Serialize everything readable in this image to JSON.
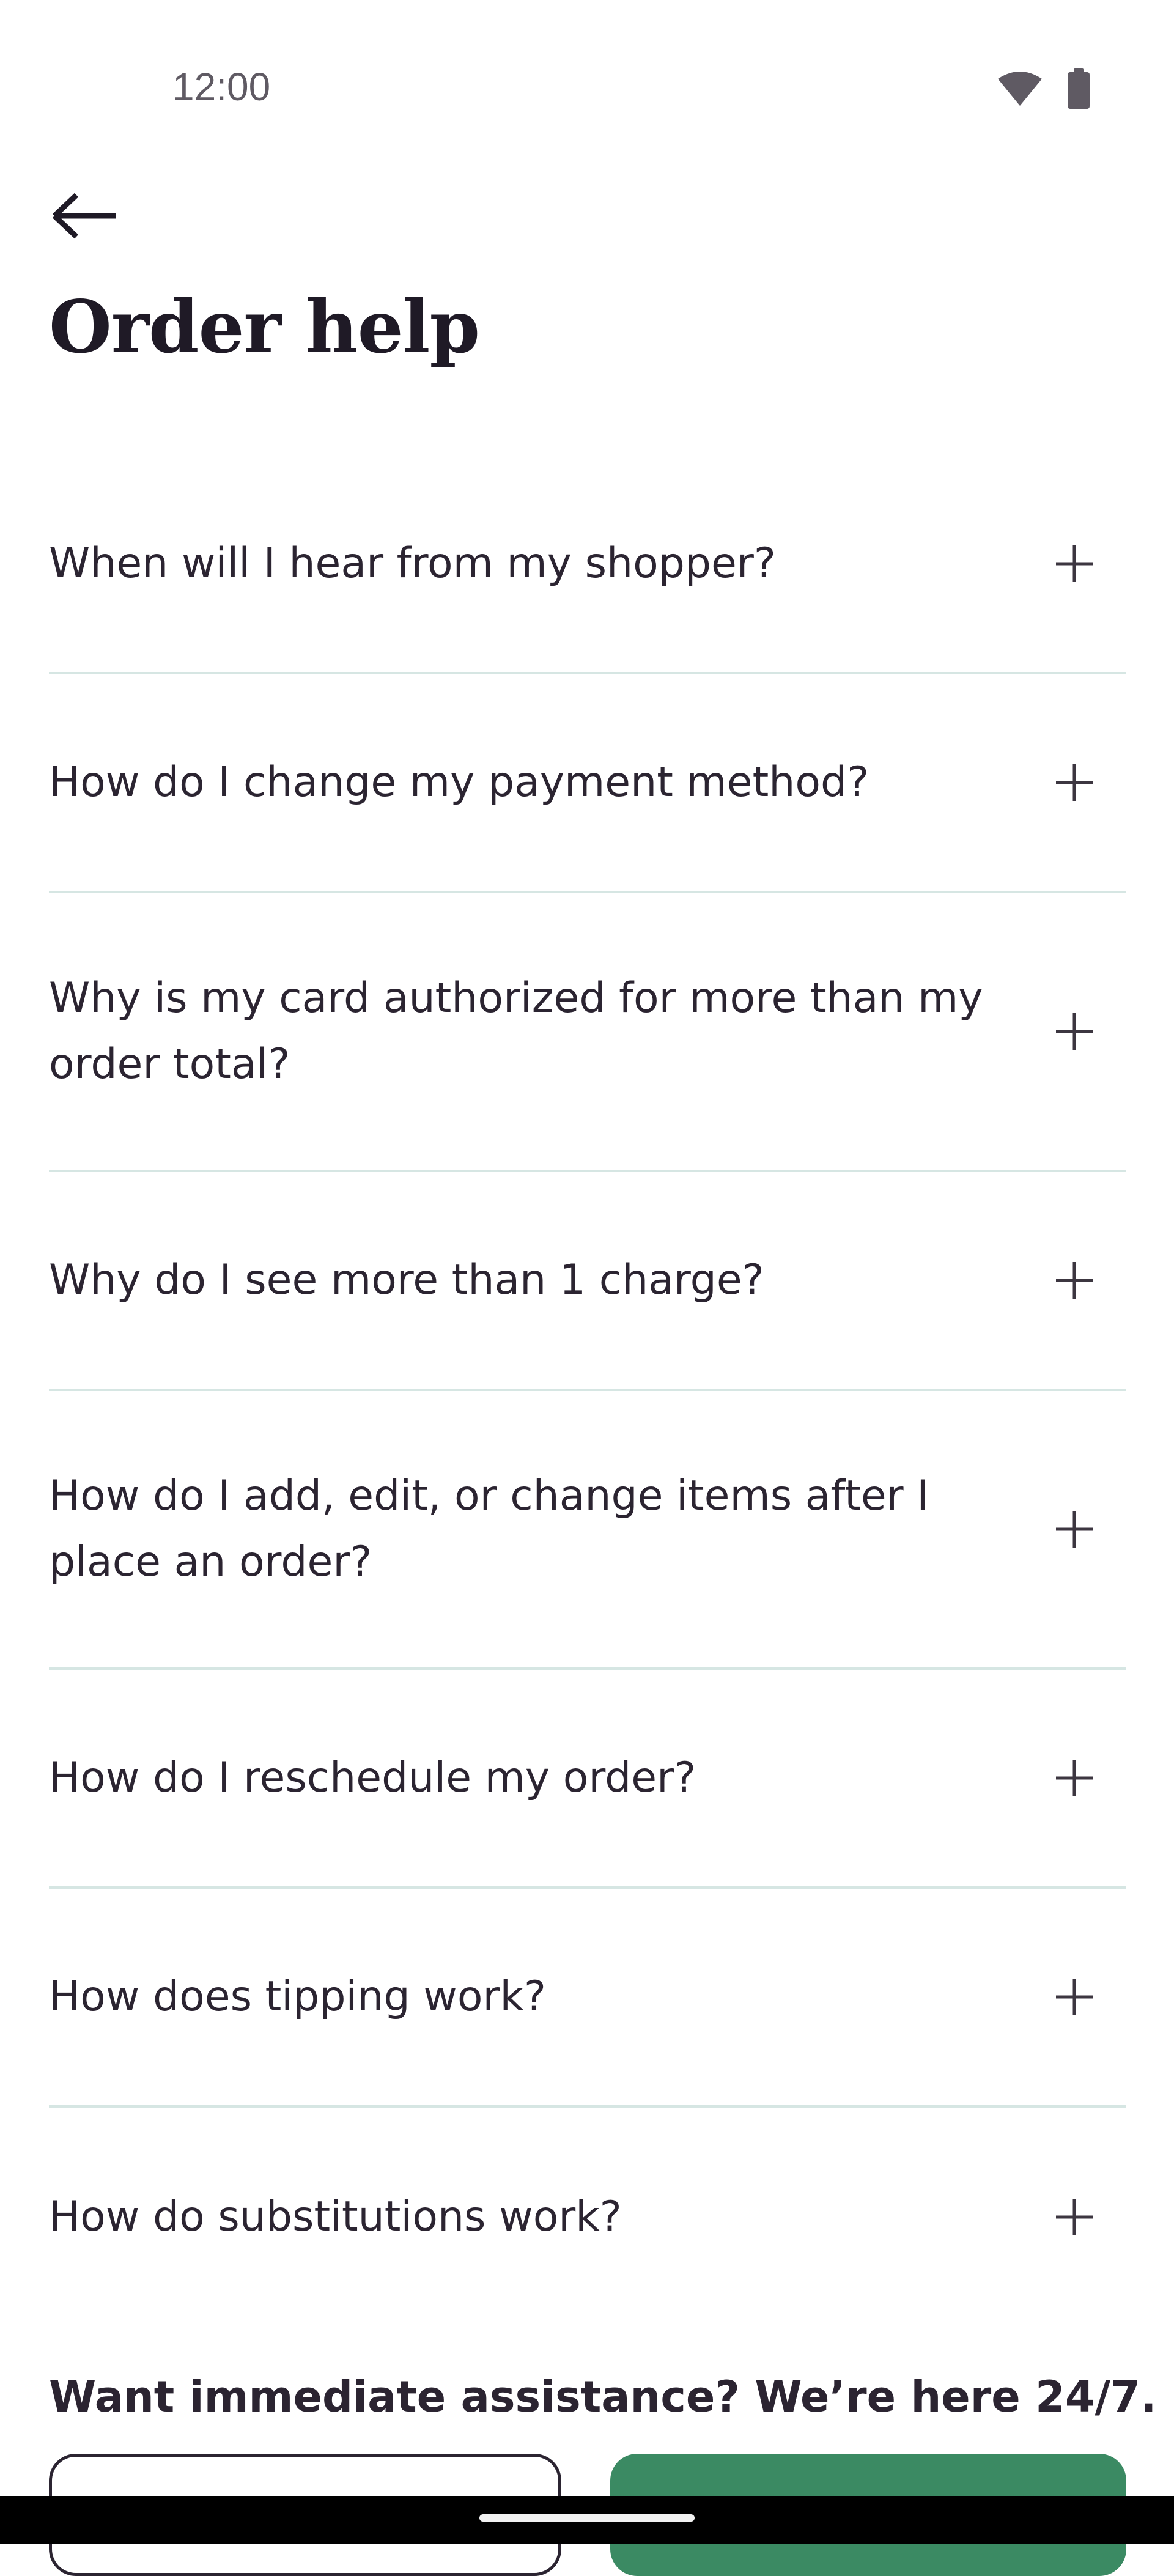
{
  "status_bar": {
    "time": "12:00",
    "icons": [
      "wifi-icon",
      "battery-icon"
    ]
  },
  "header": {
    "back_icon": "arrow-left-icon",
    "title": "Order help"
  },
  "faq": {
    "items": [
      {
        "question": "When will I hear from my shopper?"
      },
      {
        "question": "How do I change my payment method?"
      },
      {
        "question": "Why is my card authorized for more than my order total?"
      },
      {
        "question": "Why do I see more than 1 charge?"
      },
      {
        "question": "How do I add, edit, or change items after I place an order?"
      },
      {
        "question": "How do I reschedule my order?"
      },
      {
        "question": "How does tipping work?"
      },
      {
        "question": "How do substitutions work?"
      }
    ],
    "expand_icon": "plus-icon"
  },
  "assistance": {
    "heading": "Want immediate assistance? We’re here 24/7."
  },
  "colors": {
    "text": "#2b2431",
    "divider": "#d6e6e3",
    "primary_button": "#3b8a63",
    "nav_bar": "#000000"
  }
}
